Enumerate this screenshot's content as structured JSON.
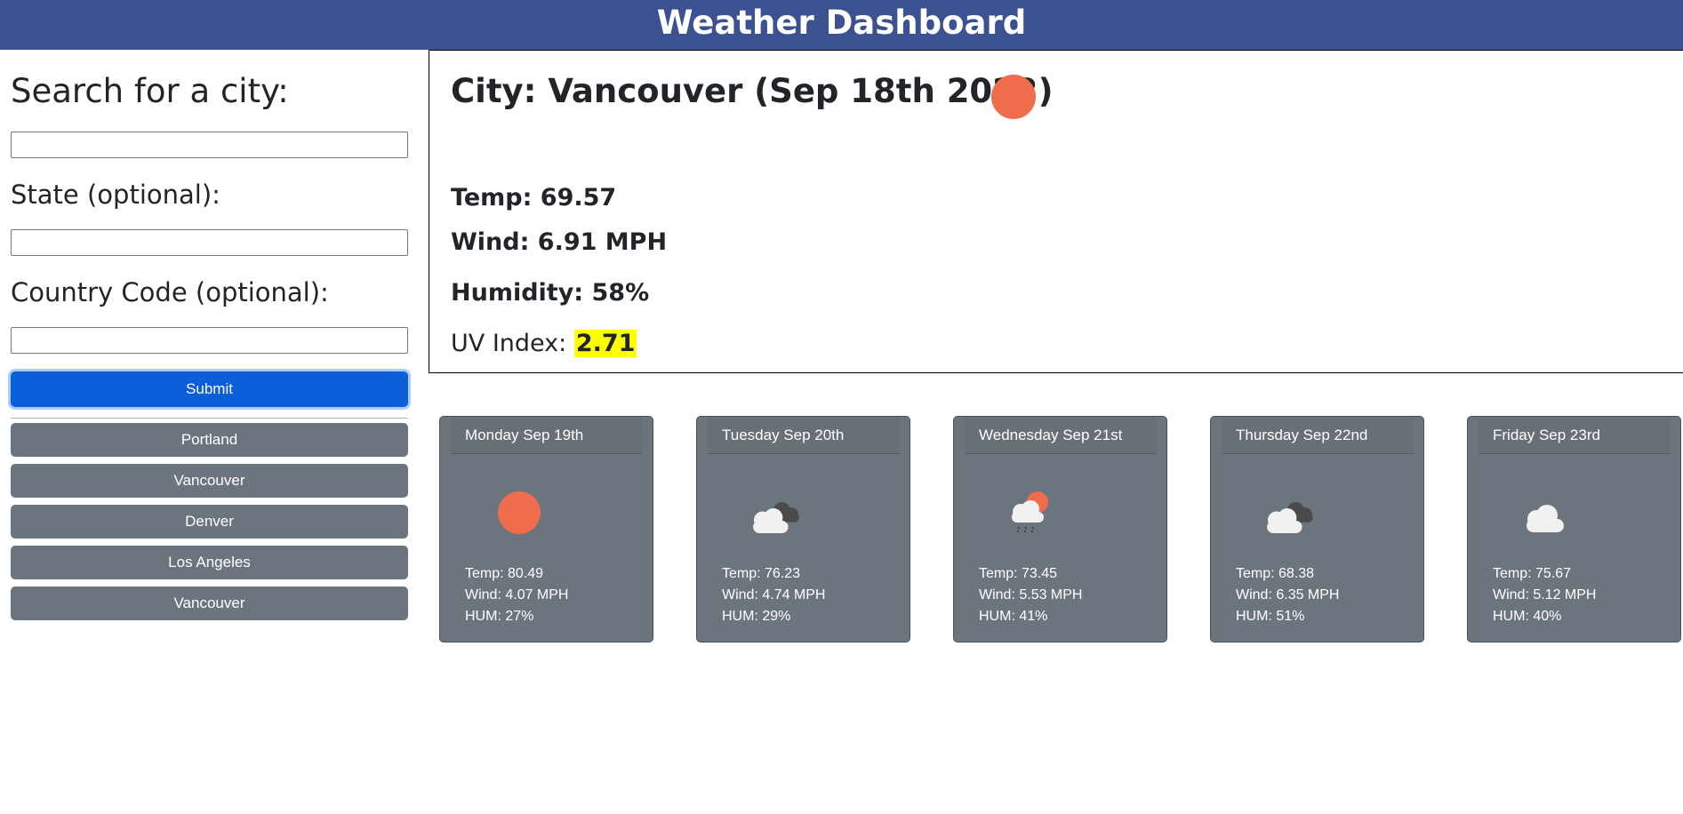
{
  "header": {
    "title": "Weather Dashboard"
  },
  "search": {
    "city_label": "Search for a city:",
    "city_value": "",
    "state_label": "State (optional):",
    "state_value": "",
    "country_label": "Country Code (optional):",
    "country_value": "",
    "submit_label": "Submit"
  },
  "history": [
    "Portland",
    "Vancouver",
    "Denver",
    "Los Angeles",
    "Vancouver"
  ],
  "current": {
    "title": "City: Vancouver (Sep 18th 2022)",
    "icon": "sun-icon",
    "temp": "Temp: 69.57",
    "wind": "Wind: 6.91 MPH",
    "humidity": "Humidity: 58%",
    "uv_label": "UV Index: ",
    "uv_value": "2.71",
    "uv_color": "#ffff00"
  },
  "forecast": [
    {
      "day": "Monday Sep 19th",
      "icon": "sun-icon",
      "temp": "Temp: 80.49",
      "wind": "Wind: 4.07 MPH",
      "hum": "HUM: 27%"
    },
    {
      "day": "Tuesday Sep 20th",
      "icon": "cloudy-icon",
      "temp": "Temp: 76.23",
      "wind": "Wind: 4.74 MPH",
      "hum": "HUM: 29%"
    },
    {
      "day": "Wednesday Sep 21st",
      "icon": "rain-sun-icon",
      "temp": "Temp: 73.45",
      "wind": "Wind: 5.53 MPH",
      "hum": "HUM: 41%"
    },
    {
      "day": "Thursday Sep 22nd",
      "icon": "cloudy-icon",
      "temp": "Temp: 68.38",
      "wind": "Wind: 6.35 MPH",
      "hum": "HUM: 51%"
    },
    {
      "day": "Friday Sep 23rd",
      "icon": "cloud-icon",
      "temp": "Temp: 75.67",
      "wind": "Wind: 5.12 MPH",
      "hum": "HUM: 40%"
    }
  ],
  "colors": {
    "header_bg": "#3b5190",
    "submit_bg": "#0d5fd9",
    "history_bg": "#6c757d",
    "card_bg": "#6c757d",
    "sun": "#ef6c4c",
    "uv_highlight": "#ffff00"
  }
}
